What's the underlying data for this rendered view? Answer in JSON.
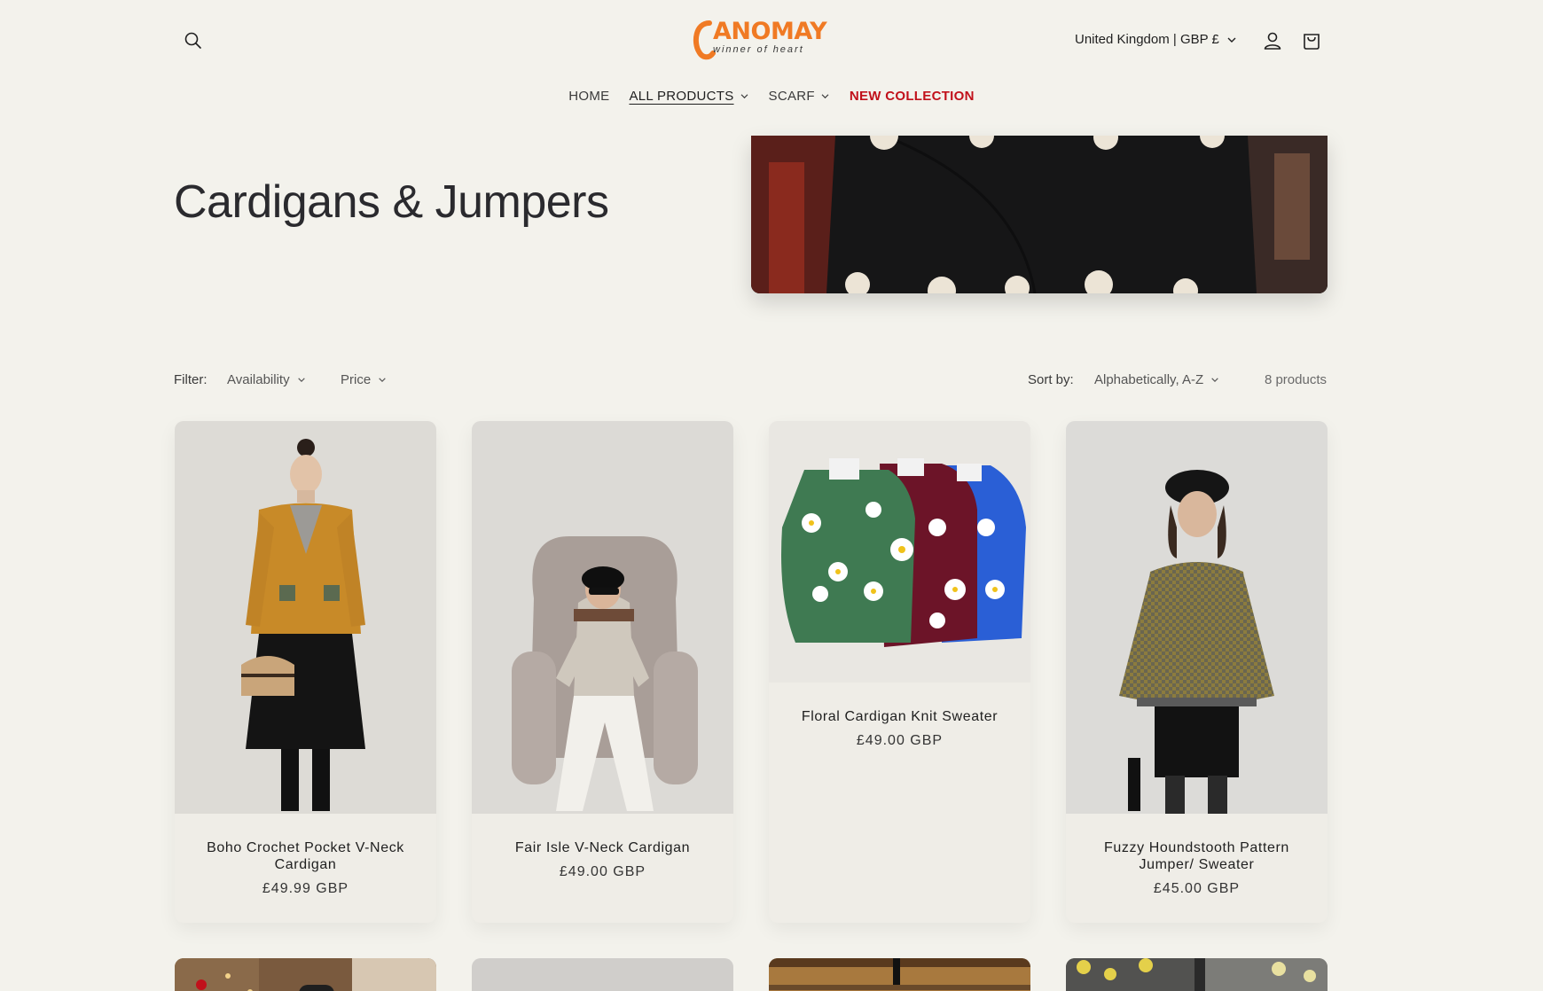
{
  "header": {
    "logo_text": "ANOMAY",
    "logo_sub": "winner of heart",
    "country_selector": "United Kingdom | GBP £",
    "nav": [
      {
        "label": "HOME",
        "dropdown": false
      },
      {
        "label": "ALL PRODUCTS",
        "dropdown": true
      },
      {
        "label": "SCARF",
        "dropdown": true
      },
      {
        "label": "NEW COLLECTION",
        "dropdown": false
      }
    ]
  },
  "collection": {
    "title": "Cardigans & Jumpers"
  },
  "filters": {
    "label": "Filter:",
    "availability": "Availability",
    "price": "Price",
    "sort_label": "Sort by:",
    "sort_value": "Alphabetically, A-Z",
    "count": "8 products"
  },
  "products": [
    {
      "name": "Boho Crochet Pocket V-Neck Cardigan",
      "price": "£49.99 GBP"
    },
    {
      "name": "Fair Isle V-Neck Cardigan",
      "price": "£49.00 GBP"
    },
    {
      "name": "Floral Cardigan Knit Sweater",
      "price": "£49.00 GBP"
    },
    {
      "name": "Fuzzy Houndstooth Pattern Jumper/ Sweater",
      "price": "£45.00 GBP"
    }
  ],
  "colors": {
    "background": "#f3f2ec",
    "accent_logo": "#f07a24",
    "new_collection": "#c1111b"
  }
}
